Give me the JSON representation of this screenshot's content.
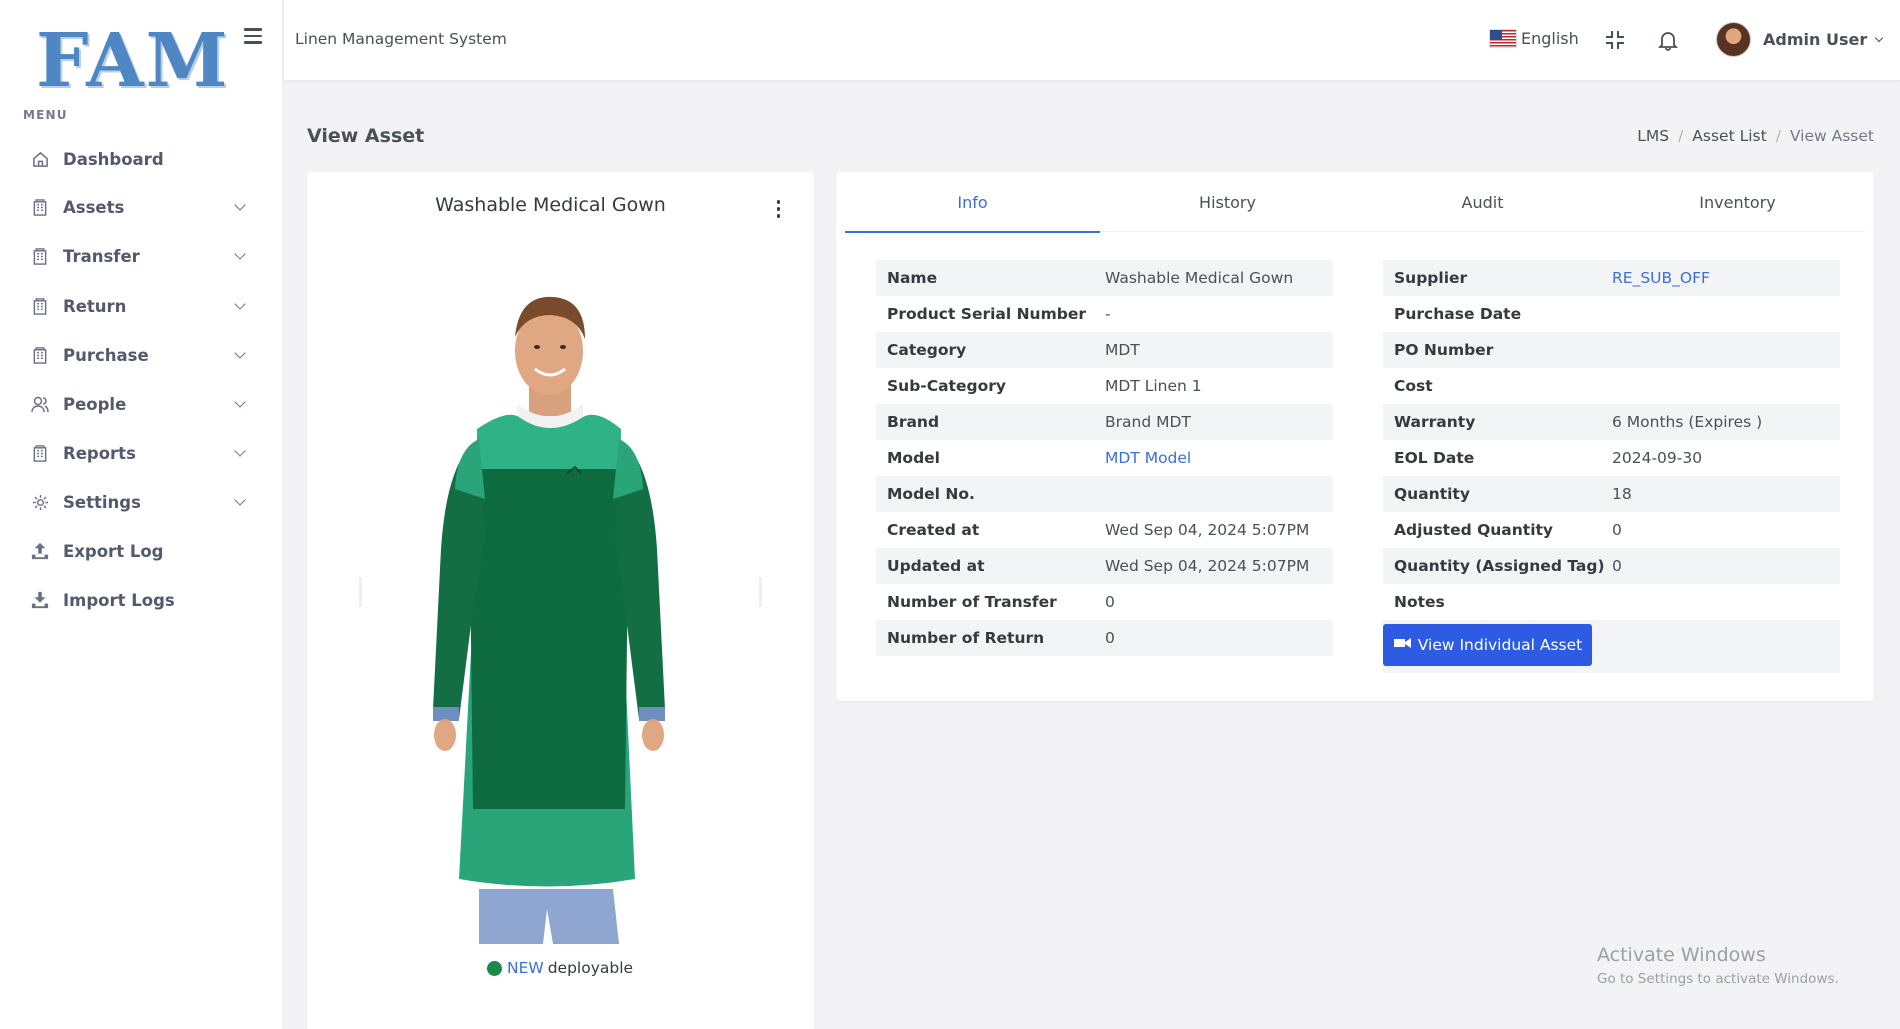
{
  "logo": {
    "text": "FAM"
  },
  "topbar": {
    "app_title": "Linen Management System",
    "language": "English",
    "user_name": "Admin User"
  },
  "sidebar": {
    "menu_title": "MENU",
    "items": [
      {
        "label": "Dashboard",
        "icon": "home-icon",
        "has_submenu": false
      },
      {
        "label": "Assets",
        "icon": "building-icon",
        "has_submenu": true
      },
      {
        "label": "Transfer",
        "icon": "building-icon",
        "has_submenu": true
      },
      {
        "label": "Return",
        "icon": "building-icon",
        "has_submenu": true
      },
      {
        "label": "Purchase",
        "icon": "building-icon",
        "has_submenu": true
      },
      {
        "label": "People",
        "icon": "users-icon",
        "has_submenu": true
      },
      {
        "label": "Reports",
        "icon": "building-icon",
        "has_submenu": true
      },
      {
        "label": "Settings",
        "icon": "gear-icon",
        "has_submenu": true
      },
      {
        "label": "Export Log",
        "icon": "upload-icon",
        "has_submenu": false
      },
      {
        "label": "Import Logs",
        "icon": "download-icon",
        "has_submenu": false
      }
    ]
  },
  "page": {
    "title": "View Asset",
    "breadcrumb": [
      "LMS",
      "Asset List",
      "View Asset"
    ]
  },
  "asset_card": {
    "title": "Washable Medical Gown",
    "status_new": "NEW",
    "status_text": "deployable",
    "status_color": "#1a8a4a"
  },
  "tabs": [
    "Info",
    "History",
    "Audit",
    "Inventory"
  ],
  "info_left": [
    {
      "key": "Name",
      "value": "Washable Medical Gown",
      "link": false
    },
    {
      "key": "Product Serial Number",
      "value": "-",
      "link": false
    },
    {
      "key": "Category",
      "value": "MDT",
      "link": false
    },
    {
      "key": "Sub-Category",
      "value": "MDT Linen 1",
      "link": false
    },
    {
      "key": "Brand",
      "value": "Brand MDT",
      "link": false
    },
    {
      "key": "Model",
      "value": "MDT Model",
      "link": true
    },
    {
      "key": "Model No.",
      "value": "",
      "link": false
    },
    {
      "key": "Created at",
      "value": "Wed Sep 04, 2024 5:07PM",
      "link": false
    },
    {
      "key": "Updated at",
      "value": "Wed Sep 04, 2024 5:07PM",
      "link": false
    },
    {
      "key": "Number of Transfer",
      "value": "0",
      "link": false
    },
    {
      "key": "Number of Return",
      "value": "0",
      "link": false
    }
  ],
  "info_right": [
    {
      "key": "Supplier",
      "value": "RE_SUB_OFF",
      "link": true
    },
    {
      "key": "Purchase Date",
      "value": "",
      "link": false
    },
    {
      "key": "PO Number",
      "value": "",
      "link": false
    },
    {
      "key": "Cost",
      "value": "",
      "link": false
    },
    {
      "key": "Warranty",
      "value": "6 Months (Expires )",
      "link": false
    },
    {
      "key": "EOL Date",
      "value": "2024-09-30",
      "link": false
    },
    {
      "key": "Quantity",
      "value": "18",
      "link": false
    },
    {
      "key": "Adjusted Quantity",
      "value": "0",
      "link": false
    },
    {
      "key": "Quantity (Assigned Tag)",
      "value": "0",
      "link": false
    },
    {
      "key": "Notes",
      "value": "",
      "link": false
    }
  ],
  "view_individual_button": "View Individual Asset",
  "watermark": {
    "line1": "Activate Windows",
    "line2": "Go to Settings to activate Windows."
  },
  "colors": {
    "primary": "#3b6fd8",
    "button": "#2d5be3",
    "gown_light": "#2aa57a",
    "gown_dark": "#0d6b3f"
  }
}
